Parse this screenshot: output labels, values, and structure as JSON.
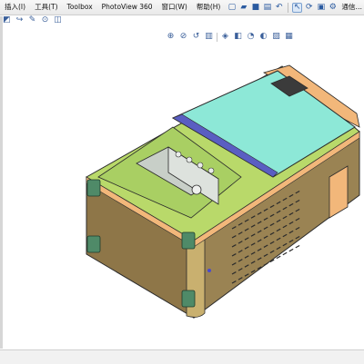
{
  "menus": [
    {
      "label": "插入(I)"
    },
    {
      "label": "工具(T)"
    },
    {
      "label": "Toolbox"
    },
    {
      "label": "PhotoView 360"
    },
    {
      "label": "窗口(W)"
    },
    {
      "label": "帮助(H)"
    }
  ],
  "right_label": "通信…",
  "toolbar_icons": [
    {
      "name": "new-document-icon",
      "glyph": "▢"
    },
    {
      "name": "open-folder-icon",
      "glyph": "▰"
    },
    {
      "name": "save-icon",
      "glyph": "■"
    },
    {
      "name": "print-icon",
      "glyph": "▤"
    },
    {
      "name": "undo-icon",
      "glyph": "↶"
    },
    {
      "name": "select-pointer-icon",
      "glyph": "↖"
    },
    {
      "name": "rebuild-icon",
      "glyph": "⟳"
    },
    {
      "name": "file-properties-icon",
      "glyph": "▣"
    },
    {
      "name": "options-icon",
      "glyph": "⚙"
    }
  ],
  "left_tools": [
    {
      "name": "fill-icon",
      "glyph": "◩"
    },
    {
      "name": "curve-icon",
      "glyph": "↪"
    },
    {
      "name": "sketch-icon",
      "glyph": "✎"
    },
    {
      "name": "target-icon",
      "glyph": "⊙"
    },
    {
      "name": "section-icon",
      "glyph": "◫"
    }
  ],
  "view_tools": [
    {
      "name": "zoom-to-fit-icon",
      "glyph": "⊕"
    },
    {
      "name": "zoom-area-icon",
      "glyph": "⊘"
    },
    {
      "name": "previous-view-icon",
      "glyph": "↺"
    },
    {
      "name": "section-view-icon",
      "glyph": "▥"
    },
    {
      "name": "view-orientation-icon",
      "glyph": "◈"
    },
    {
      "name": "display-style-icon",
      "glyph": "◧"
    },
    {
      "name": "hide-show-icon",
      "glyph": "◔"
    },
    {
      "name": "appearance-icon",
      "glyph": "◐"
    },
    {
      "name": "scene-icon",
      "glyph": "▨"
    },
    {
      "name": "view-settings-icon",
      "glyph": "▦"
    }
  ],
  "colors": {
    "top_panel": "#8de8d7",
    "frame": "#b9d96a",
    "orange": "#f2b77a",
    "side": "#9a8353",
    "front": "#8e7648",
    "bracket": "#4f8a68",
    "divider": "#5a5ec2"
  }
}
